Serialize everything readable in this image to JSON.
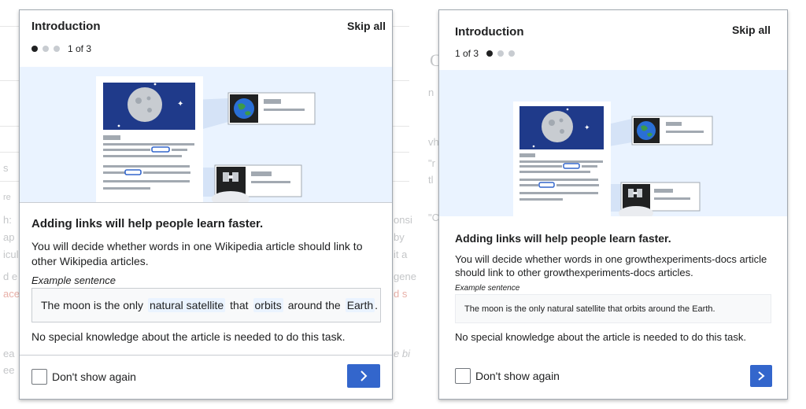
{
  "left_dialog": {
    "title": "Introduction",
    "skip_label": "Skip all",
    "page_indicator": "1 of 3",
    "heading": "Adding links will help people learn faster.",
    "description": "You will decide whether words in one Wikipedia article should link to other Wikipedia articles.",
    "example_label": "Example sentence",
    "example": {
      "part1": "The moon is the only",
      "link1": "natural satellite",
      "part2": "that",
      "link2": "orbits",
      "part3": "around the",
      "link3": "Earth",
      "part4": "."
    },
    "note": "No special knowledge about the article is needed to do this task.",
    "checkbox_label": "Don't show again"
  },
  "right_dialog": {
    "title": "Introduction",
    "skip_label": "Skip all",
    "page_indicator": "1 of 3",
    "heading": "Adding links will help people learn faster.",
    "description": "You will decide whether words in one growthexperiments-docs article should link to other growthexperiments-docs articles.",
    "example_label": "Example sentence",
    "example_text": "The moon is the only natural satellite that orbits around the Earth.",
    "note": "No special knowledge about the article is needed to do this task.",
    "checkbox_label": "Don't show again"
  },
  "background_fragments": {
    "left": [
      "s",
      "re",
      "h:",
      "ap",
      "icul",
      "d e",
      "ace",
      "ea",
      "ee"
    ],
    "left_right_edge": [
      "onsi",
      "by",
      "it a",
      "gene",
      "d s",
      "e bi"
    ],
    "right": [
      "C",
      "n",
      "vh",
      "\"r",
      "tl",
      "\"C"
    ]
  },
  "colors": {
    "accent": "#3366cc",
    "illustration_bg": "#eaf3ff",
    "link_highlight": "#eaf3ff",
    "dot_active": "#202122",
    "dot_inactive": "#c8ccd1"
  },
  "icons": [
    "chevron-right-icon",
    "moon-icon",
    "earth-icon",
    "satellite-icon",
    "star-icon"
  ]
}
